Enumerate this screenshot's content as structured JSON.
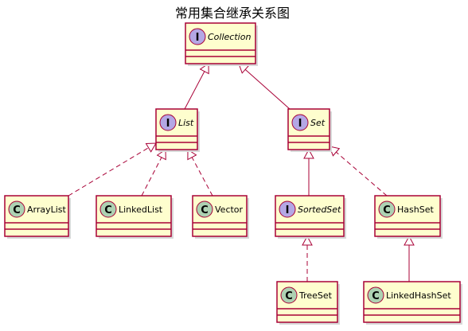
{
  "title": "常用集合继承关系图",
  "colors": {
    "box_fill": "#FEFECE",
    "box_stroke": "#A80036",
    "interface_badge": "#B4A7E5",
    "class_badge": "#ADD1B2",
    "badge_stroke": "#A80036",
    "line": "#A80036",
    "title": "#000000"
  },
  "nodes": [
    {
      "id": "collection",
      "name": "Collection",
      "kind": "interface",
      "badge": "I",
      "italic": true
    },
    {
      "id": "list",
      "name": "List",
      "kind": "interface",
      "badge": "I",
      "italic": true
    },
    {
      "id": "set",
      "name": "Set",
      "kind": "interface",
      "badge": "I",
      "italic": true
    },
    {
      "id": "arraylist",
      "name": "ArrayList",
      "kind": "class",
      "badge": "C",
      "italic": false
    },
    {
      "id": "linkedlist",
      "name": "LinkedList",
      "kind": "class",
      "badge": "C",
      "italic": false
    },
    {
      "id": "vector",
      "name": "Vector",
      "kind": "class",
      "badge": "C",
      "italic": false
    },
    {
      "id": "sortedset",
      "name": "SortedSet",
      "kind": "interface",
      "badge": "I",
      "italic": true
    },
    {
      "id": "hashset",
      "name": "HashSet",
      "kind": "class",
      "badge": "C",
      "italic": false
    },
    {
      "id": "treeset",
      "name": "TreeSet",
      "kind": "class",
      "badge": "C",
      "italic": false
    },
    {
      "id": "linkedhashset",
      "name": "LinkedHashSet",
      "kind": "class",
      "badge": "C",
      "italic": false
    }
  ],
  "edges": [
    {
      "from": "list",
      "to": "collection",
      "relation": "extends"
    },
    {
      "from": "set",
      "to": "collection",
      "relation": "extends"
    },
    {
      "from": "arraylist",
      "to": "list",
      "relation": "implements"
    },
    {
      "from": "linkedlist",
      "to": "list",
      "relation": "implements"
    },
    {
      "from": "vector",
      "to": "list",
      "relation": "implements"
    },
    {
      "from": "sortedset",
      "to": "set",
      "relation": "extends"
    },
    {
      "from": "hashset",
      "to": "set",
      "relation": "implements"
    },
    {
      "from": "treeset",
      "to": "sortedset",
      "relation": "implements"
    },
    {
      "from": "linkedhashset",
      "to": "hashset",
      "relation": "extends"
    }
  ]
}
